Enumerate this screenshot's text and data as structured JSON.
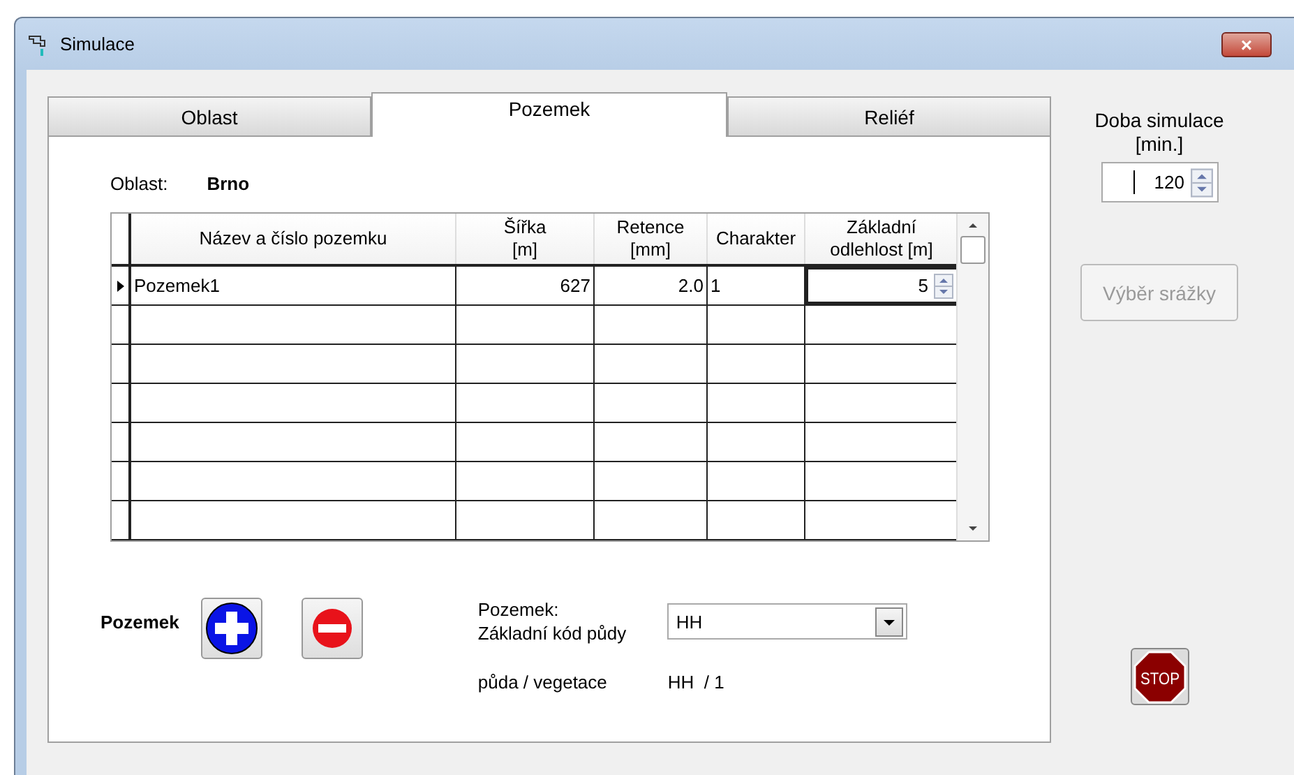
{
  "window": {
    "title": "Simulace",
    "close": "×"
  },
  "tabs": [
    {
      "label": "Oblast",
      "selected": false
    },
    {
      "label": "Pozemek",
      "selected": true
    },
    {
      "label": "Reliéf",
      "selected": false
    }
  ],
  "area": {
    "label": "Oblast:",
    "value": "Brno"
  },
  "table": {
    "columns": [
      "Název a číslo pozemku",
      "Šířka\n[m]",
      "Retence\n[mm]",
      "Charakter",
      "Základní\nodlehlost [m]"
    ],
    "rows": [
      {
        "selected": true,
        "cells": [
          "Pozemek1",
          "627",
          "2.0",
          "1",
          "5"
        ]
      }
    ]
  },
  "plot_controls": {
    "label": "Pozemek"
  },
  "soil": {
    "label": "Pozemek:\nZákladní kód půdy",
    "value": "HH",
    "pair_label": "půda / vegetace",
    "pair_value": "HH  / 1"
  },
  "simulation": {
    "label": "Doba simulace\n[min.]",
    "value": "120"
  },
  "rain_button": {
    "label": "Výběr srážky",
    "disabled": true
  },
  "stop_button": {
    "label": "STOP"
  }
}
